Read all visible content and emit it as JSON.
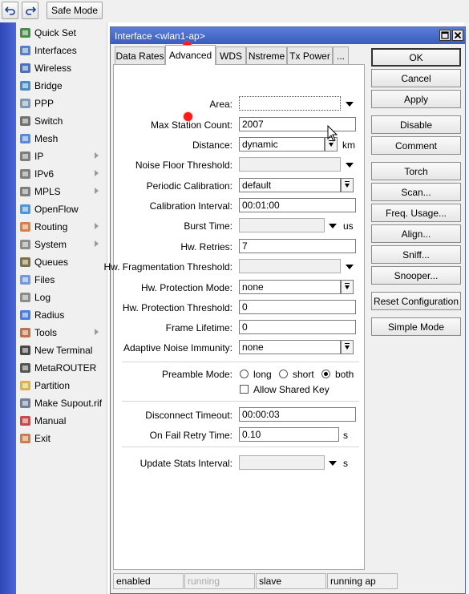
{
  "toolbar": {
    "undo_icon": "undo-icon",
    "redo_icon": "redo-icon",
    "safe_mode_label": "Safe Mode"
  },
  "sidebar": {
    "items": [
      {
        "label": "Quick Set",
        "icon": "quick-set-icon",
        "submenu": false
      },
      {
        "label": "Interfaces",
        "icon": "interfaces-icon",
        "submenu": false
      },
      {
        "label": "Wireless",
        "icon": "wireless-icon",
        "submenu": false
      },
      {
        "label": "Bridge",
        "icon": "bridge-icon",
        "submenu": false
      },
      {
        "label": "PPP",
        "icon": "ppp-icon",
        "submenu": false
      },
      {
        "label": "Switch",
        "icon": "switch-icon",
        "submenu": false
      },
      {
        "label": "Mesh",
        "icon": "mesh-icon",
        "submenu": false
      },
      {
        "label": "IP",
        "icon": "ip-icon",
        "submenu": true
      },
      {
        "label": "IPv6",
        "icon": "ipv6-icon",
        "submenu": true
      },
      {
        "label": "MPLS",
        "icon": "mpls-icon",
        "submenu": true
      },
      {
        "label": "OpenFlow",
        "icon": "openflow-icon",
        "submenu": false
      },
      {
        "label": "Routing",
        "icon": "routing-icon",
        "submenu": true
      },
      {
        "label": "System",
        "icon": "system-icon",
        "submenu": true
      },
      {
        "label": "Queues",
        "icon": "queues-icon",
        "submenu": false
      },
      {
        "label": "Files",
        "icon": "files-icon",
        "submenu": false
      },
      {
        "label": "Log",
        "icon": "log-icon",
        "submenu": false
      },
      {
        "label": "Radius",
        "icon": "radius-icon",
        "submenu": false
      },
      {
        "label": "Tools",
        "icon": "tools-icon",
        "submenu": true
      },
      {
        "label": "New Terminal",
        "icon": "terminal-icon",
        "submenu": false
      },
      {
        "label": "MetaROUTER",
        "icon": "metarouter-icon",
        "submenu": false
      },
      {
        "label": "Partition",
        "icon": "partition-icon",
        "submenu": false
      },
      {
        "label": "Make Supout.rif",
        "icon": "supout-icon",
        "submenu": false
      },
      {
        "label": "Manual",
        "icon": "manual-icon",
        "submenu": false
      },
      {
        "label": "Exit",
        "icon": "exit-icon",
        "submenu": false
      }
    ]
  },
  "dialog": {
    "title": "Interface <wlan1-ap>",
    "tabs": [
      "Data Rates",
      "Advanced",
      "WDS",
      "Nstreme",
      "Tx Power",
      "..."
    ],
    "active_tab": "Advanced",
    "fields": {
      "area": {
        "label": "Area:",
        "value": ""
      },
      "max_station_count": {
        "label": "Max Station Count:",
        "value": "2007"
      },
      "distance": {
        "label": "Distance:",
        "value": "dynamic",
        "unit": "km"
      },
      "noise_floor_threshold": {
        "label": "Noise Floor Threshold:",
        "value": ""
      },
      "periodic_calibration": {
        "label": "Periodic Calibration:",
        "value": "default"
      },
      "calibration_interval": {
        "label": "Calibration Interval:",
        "value": "00:01:00"
      },
      "burst_time": {
        "label": "Burst Time:",
        "value": "",
        "unit": "us"
      },
      "hw_retries": {
        "label": "Hw. Retries:",
        "value": "7"
      },
      "hw_fragmentation_threshold": {
        "label": "Hw. Fragmentation Threshold:",
        "value": ""
      },
      "hw_protection_mode": {
        "label": "Hw. Protection Mode:",
        "value": "none"
      },
      "hw_protection_threshold": {
        "label": "Hw. Protection Threshold:",
        "value": "0"
      },
      "frame_lifetime": {
        "label": "Frame Lifetime:",
        "value": "0"
      },
      "adaptive_noise_immunity": {
        "label": "Adaptive Noise Immunity:",
        "value": "none"
      },
      "preamble_mode": {
        "label": "Preamble Mode:",
        "options": [
          "long",
          "short",
          "both"
        ],
        "selected": "both"
      },
      "allow_shared_key": {
        "label": "Allow Shared Key",
        "checked": false
      },
      "disconnect_timeout": {
        "label": "Disconnect Timeout:",
        "value": "00:00:03"
      },
      "on_fail_retry_time": {
        "label": "On Fail Retry Time:",
        "value": "0.10",
        "unit": "s"
      },
      "update_stats_interval": {
        "label": "Update Stats Interval:",
        "value": "",
        "unit": "s"
      }
    },
    "buttons": [
      "OK",
      "Cancel",
      "Apply",
      "Disable",
      "Comment",
      "Torch",
      "Scan...",
      "Freq. Usage...",
      "Align...",
      "Sniff...",
      "Snooper...",
      "Reset Configuration",
      "Simple Mode"
    ],
    "status": [
      "enabled",
      "running",
      "slave",
      "running ap"
    ]
  }
}
